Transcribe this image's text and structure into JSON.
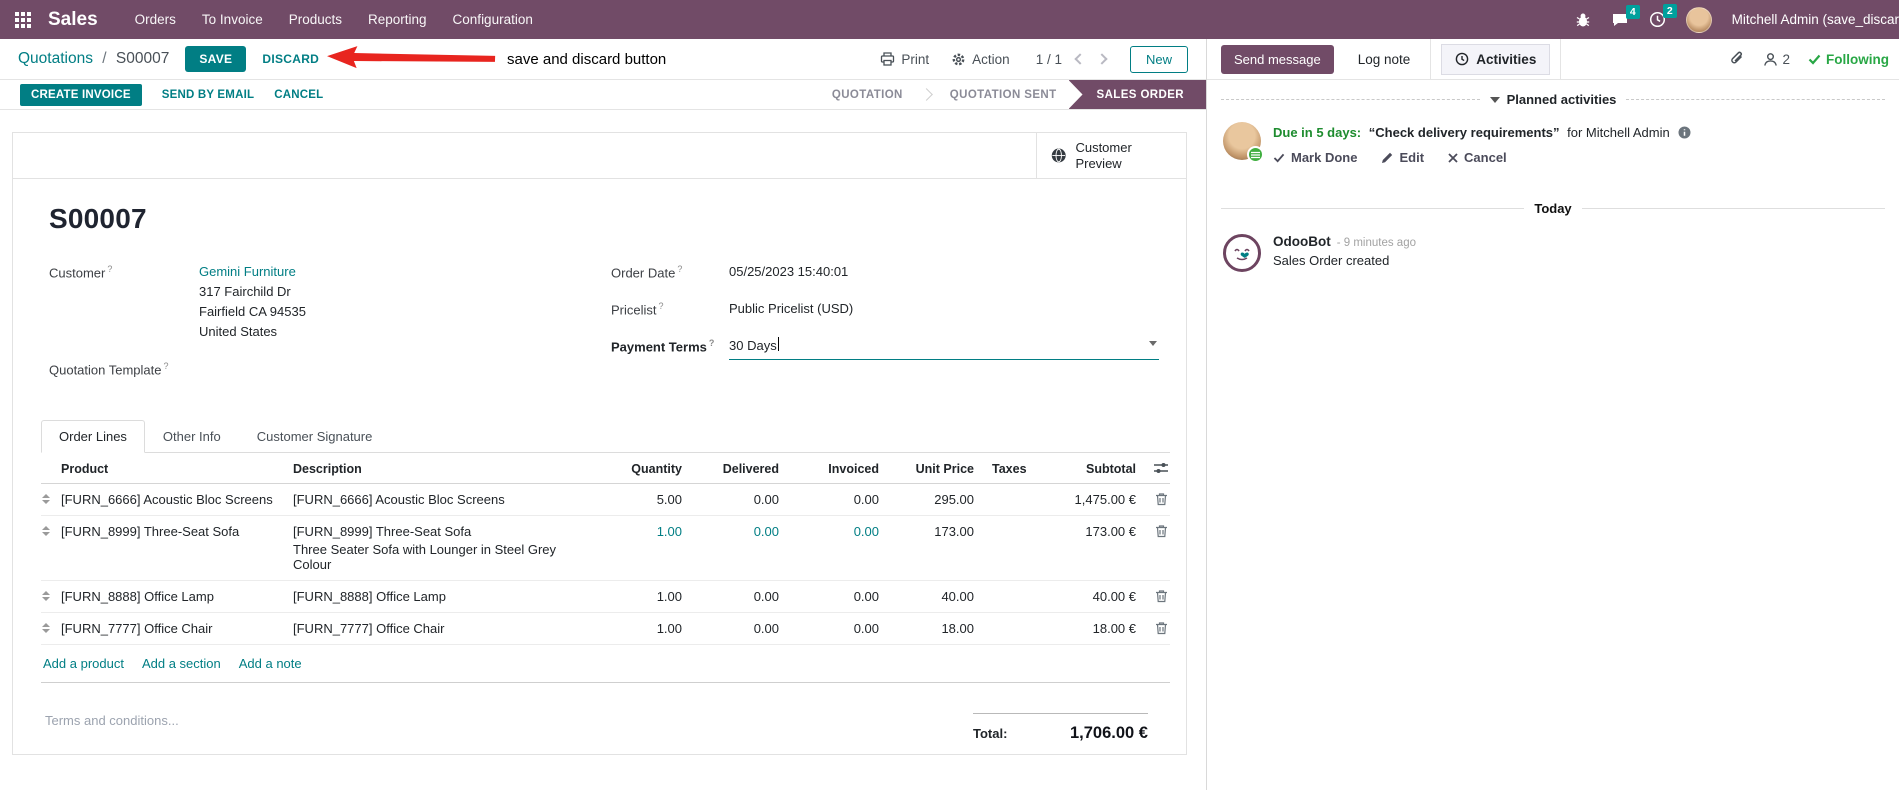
{
  "colors": {
    "navbar": "#714B67",
    "primary_teal": "#017E84",
    "badge_teal": "#00A09D",
    "success_green": "#28a745",
    "annotation_red": "#e8251f"
  },
  "nav": {
    "app_name": "Sales",
    "menus": [
      "Orders",
      "To Invoice",
      "Products",
      "Reporting",
      "Configuration"
    ],
    "messages_badge": "4",
    "activities_badge": "2",
    "user_name": "Mitchell Admin (save_discar"
  },
  "control_panel": {
    "breadcrumb_parent": "Quotations",
    "breadcrumb_separator": "/",
    "breadcrumb_current": "S00007",
    "save_label": "SAVE",
    "discard_label": "DISCARD",
    "print_label": "Print",
    "action_label": "Action",
    "pager": "1 / 1",
    "new_label": "New"
  },
  "annotation": {
    "text": "save and discard button"
  },
  "statusbar": {
    "buttons": [
      "CREATE INVOICE",
      "SEND BY EMAIL",
      "CANCEL"
    ],
    "states": [
      "QUOTATION",
      "QUOTATION SENT",
      "SALES ORDER"
    ],
    "active_state": "SALES ORDER"
  },
  "form": {
    "customer_preview_label": "Customer Preview",
    "title": "S00007",
    "fields": {
      "customer_label": "Customer",
      "customer_name": "Gemini Furniture",
      "address_lines": [
        "317 Fairchild Dr",
        "Fairfield CA 94535",
        "United States"
      ],
      "quotation_template_label": "Quotation Template",
      "order_date_label": "Order Date",
      "order_date_value": "05/25/2023 15:40:01",
      "pricelist_label": "Pricelist",
      "pricelist_value": "Public Pricelist (USD)",
      "payment_terms_label": "Payment Terms",
      "payment_terms_value": "30 Days"
    },
    "tabs": [
      "Order Lines",
      "Other Info",
      "Customer Signature"
    ],
    "order_lines": {
      "columns": [
        "Product",
        "Description",
        "Quantity",
        "Delivered",
        "Invoiced",
        "Unit Price",
        "Taxes",
        "Subtotal"
      ],
      "rows": [
        {
          "product": "[FURN_6666] Acoustic Bloc Screens",
          "description": "[FURN_6666] Acoustic Bloc Screens",
          "description2": "",
          "quantity": "5.00",
          "delivered": "0.00",
          "invoiced": "0.00",
          "unit_price": "295.00",
          "taxes": "",
          "subtotal": "1,475.00 €"
        },
        {
          "product": "[FURN_8999] Three-Seat Sofa",
          "description": "[FURN_8999] Three-Seat Sofa",
          "description2": "Three Seater Sofa with Lounger in Steel Grey Colour",
          "quantity": "1.00",
          "delivered": "0.00",
          "invoiced": "0.00",
          "unit_price": "173.00",
          "taxes": "",
          "subtotal": "173.00 €"
        },
        {
          "product": "[FURN_8888] Office Lamp",
          "description": "[FURN_8888] Office Lamp",
          "description2": "",
          "quantity": "1.00",
          "delivered": "0.00",
          "invoiced": "0.00",
          "unit_price": "40.00",
          "taxes": "",
          "subtotal": "40.00 €"
        },
        {
          "product": "[FURN_7777] Office Chair",
          "description": "[FURN_7777] Office Chair",
          "description2": "",
          "quantity": "1.00",
          "delivered": "0.00",
          "invoiced": "0.00",
          "unit_price": "18.00",
          "taxes": "",
          "subtotal": "18.00 €"
        }
      ],
      "links": [
        "Add a product",
        "Add a section",
        "Add a note"
      ]
    },
    "terms_placeholder": "Terms and conditions...",
    "total_label": "Total:",
    "total_value": "1,706.00 €"
  },
  "chatter": {
    "send_message_label": "Send message",
    "log_note_label": "Log note",
    "activities_label": "Activities",
    "followers_count": "2",
    "following_label": "Following",
    "planned_header": "Planned activities",
    "activity": {
      "due": "Due in 5 days:",
      "summary": "“Check delivery requirements”",
      "for_text": "for Mitchell Admin",
      "actions": [
        "Mark Done",
        "Edit",
        "Cancel"
      ]
    },
    "today_label": "Today",
    "message": {
      "author": "OdooBot",
      "time": "- 9 minutes ago",
      "body": "Sales Order created"
    }
  }
}
